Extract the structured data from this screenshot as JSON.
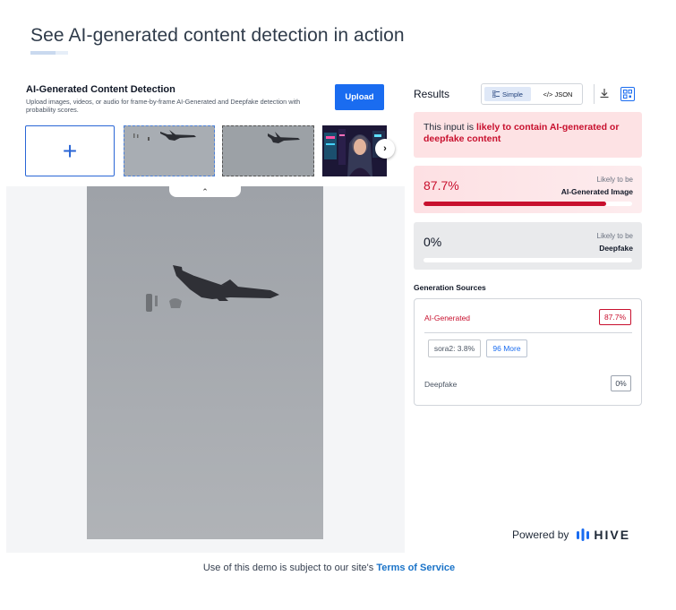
{
  "page": {
    "title": "See AI-generated content detection in action"
  },
  "detector": {
    "title": "AI-Generated Content Detection",
    "description": "Upload images, videos, or audio for frame-by-frame AI-Generated and Deepfake detection with probability scores.",
    "upload_label": "Upload",
    "add_icon": "plus-icon",
    "next_icon": "chevron-right-icon",
    "collapse_icon": "chevron-up-icon"
  },
  "results": {
    "title": "Results",
    "toggle": {
      "simple_label": "Simple",
      "json_label": "</> JSON",
      "selected": "Simple"
    },
    "alert": {
      "prefix": "This input is ",
      "highlight": "likely to contain AI-generated or deepfake content"
    },
    "ai_score": {
      "value": "87.7%",
      "fraction": 0.877,
      "likely": "Likely to be",
      "label": "AI-Generated Image"
    },
    "deepfake_score": {
      "value": "0%",
      "fraction": 0.0,
      "likely": "Likely to be",
      "label": "Deepfake"
    },
    "generation_sources": {
      "title": "Generation Sources",
      "ai_label": "AI-Generated",
      "ai_value": "87.7%",
      "chip_sora": "sora2: 3.8%",
      "chip_more": "96 More",
      "deepfake_label": "Deepfake",
      "deepfake_value": "0%"
    },
    "powered_by": "Powered by",
    "brand": "HIVE"
  },
  "footer": {
    "prefix": "Use of this demo is subject to our site's ",
    "link": "Terms of Service"
  },
  "colors": {
    "accent": "#1a6cf0",
    "alert_red": "#c8102e"
  }
}
